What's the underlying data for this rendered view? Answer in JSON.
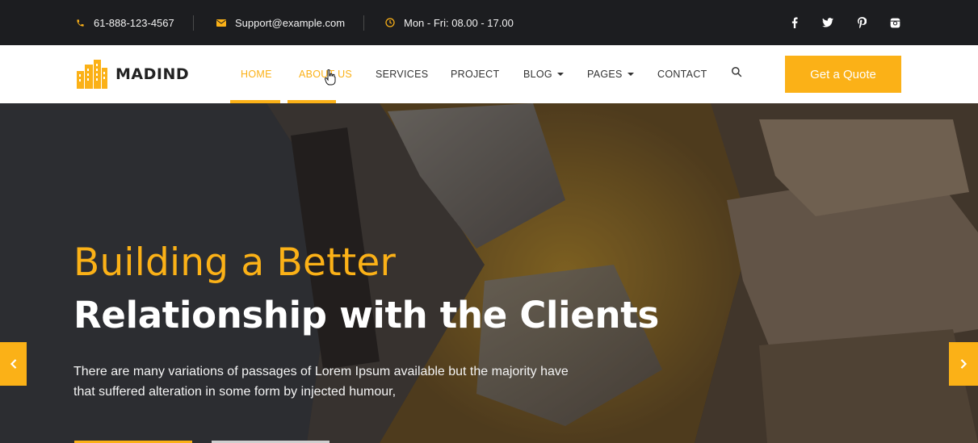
{
  "topbar": {
    "phone": "61-888-123-4567",
    "email": "Support@example.com",
    "hours": "Mon - Fri: 08.00 - 17.00",
    "socials": [
      {
        "name": "facebook-icon",
        "glyph": "f"
      },
      {
        "name": "twitter-icon",
        "glyph": "twitter"
      },
      {
        "name": "pinterest-icon",
        "glyph": "p"
      },
      {
        "name": "instagram-icon",
        "glyph": "ig"
      }
    ]
  },
  "logo": {
    "text": "MADIND"
  },
  "nav": {
    "items": [
      {
        "label": "HOME",
        "state": "active"
      },
      {
        "label": "ABOUT US",
        "state": "hovered"
      },
      {
        "label": "SERVICES"
      },
      {
        "label": "PROJECT"
      },
      {
        "label": "BLOG",
        "dropdown": true
      },
      {
        "label": "PAGES",
        "dropdown": true
      },
      {
        "label": "CONTACT"
      }
    ],
    "quote_label": "Get a Quote"
  },
  "hero": {
    "headline": "Building a Better",
    "subheadline": "Relationship with the Clients",
    "body": "There are many variations of passages of Lorem Ipsum available but the majority have that suffered alteration in some form by injected humour,"
  },
  "colors": {
    "accent": "#fbb117",
    "topbar_bg": "#1c1d20",
    "text_dark": "#333333"
  }
}
